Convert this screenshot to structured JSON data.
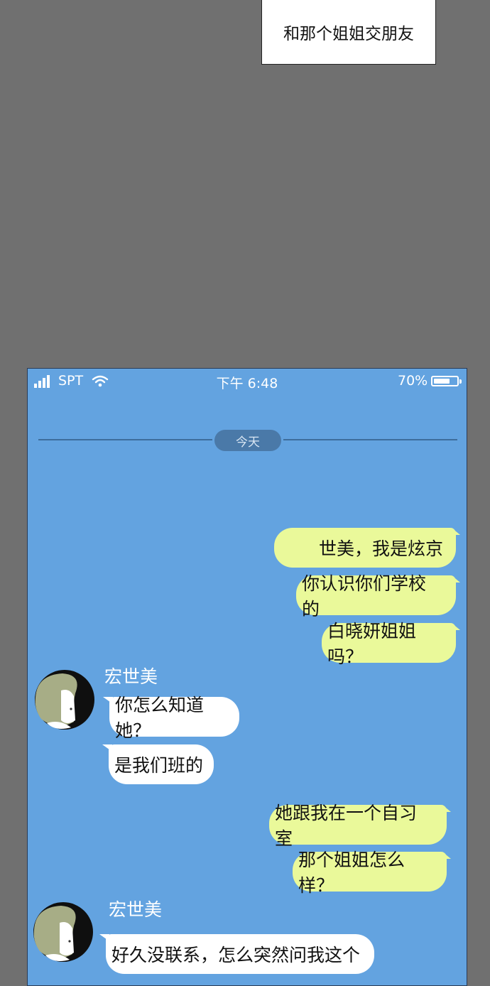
{
  "caption": "和那个姐姐交朋友",
  "status_bar": {
    "carrier": "SPT",
    "time": "下午 6:48",
    "battery_percent": "70%",
    "battery_level": 0.7,
    "signal_bars": 4,
    "icons": [
      "signal-icon",
      "wifi-icon",
      "battery-icon"
    ]
  },
  "chat": {
    "date_label": "今天",
    "contact_name": "宏世美",
    "messages": [
      {
        "side": "out",
        "text": "世美，我是炫京"
      },
      {
        "side": "out",
        "text": "你认识你们学校的"
      },
      {
        "side": "out",
        "text": "白晓妍姐姐吗？"
      },
      {
        "side": "in",
        "sender": "宏世美",
        "text": "你怎么知道她？"
      },
      {
        "side": "in",
        "text": "是我们班的"
      },
      {
        "side": "out",
        "text": "她跟我在一个自习室"
      },
      {
        "side": "out",
        "text": "那个姐姐怎么样？"
      },
      {
        "side": "in",
        "sender": "宏世美",
        "text": "好久没联系，怎么突然问我这个"
      }
    ]
  },
  "colors": {
    "page_background": "#707070",
    "chat_background": "#63a3e0",
    "outgoing_bubble": "#eaf99a",
    "incoming_bubble": "#ffffff",
    "date_pill": "#4a79a8"
  }
}
